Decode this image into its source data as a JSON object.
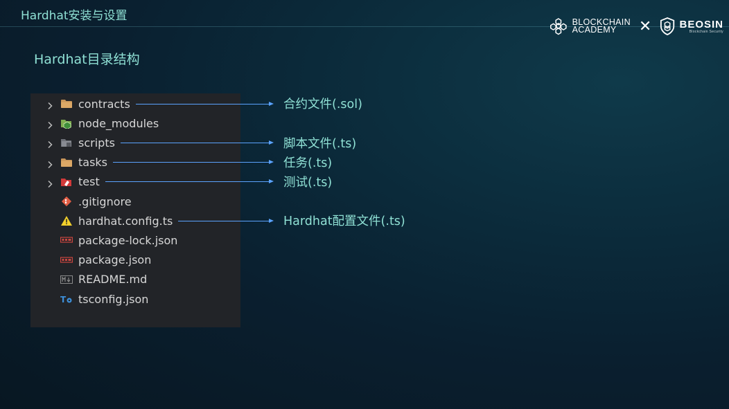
{
  "header": {
    "title": "Hardhat安装与设置"
  },
  "brand": {
    "blockchain_line1": "BLOCKCHAIN",
    "blockchain_line2": "ACADEMY",
    "cross": "✕",
    "beosin": "BEOSIN",
    "beosin_sub": "Blockchain Security"
  },
  "section": {
    "title": "Hardhat目录结构"
  },
  "explorer": {
    "items": [
      {
        "name": "contracts",
        "icon": "folder-icon",
        "expandable": true
      },
      {
        "name": "node_modules",
        "icon": "node-folder-icon",
        "expandable": true
      },
      {
        "name": "scripts",
        "icon": "scripts-folder-icon",
        "expandable": true
      },
      {
        "name": "tasks",
        "icon": "folder-icon",
        "expandable": true
      },
      {
        "name": "test",
        "icon": "test-folder-icon",
        "expandable": true
      },
      {
        "name": ".gitignore",
        "icon": "git-icon",
        "expandable": false
      },
      {
        "name": "hardhat.config.ts",
        "icon": "warning-icon",
        "expandable": false
      },
      {
        "name": "package-lock.json",
        "icon": "npm-icon",
        "expandable": false
      },
      {
        "name": "package.json",
        "icon": "npm-icon",
        "expandable": false
      },
      {
        "name": "README.md",
        "icon": "markdown-icon",
        "expandable": false
      },
      {
        "name": "tsconfig.json",
        "icon": "tsconfig-icon",
        "expandable": false
      }
    ]
  },
  "annotations": [
    {
      "label": "合约文件(.sol)",
      "target": "contracts"
    },
    {
      "label": "脚本文件(.ts)",
      "target": "scripts"
    },
    {
      "label": "任务(.ts)",
      "target": "tasks"
    },
    {
      "label": "测试(.ts)",
      "target": "test"
    },
    {
      "label": "Hardhat配置文件(.ts)",
      "target": "hardhat.config.ts"
    }
  ],
  "colors": {
    "accent_text": "#8fe0d4",
    "arrow": "#5ba3ff",
    "panel": "#222428"
  }
}
